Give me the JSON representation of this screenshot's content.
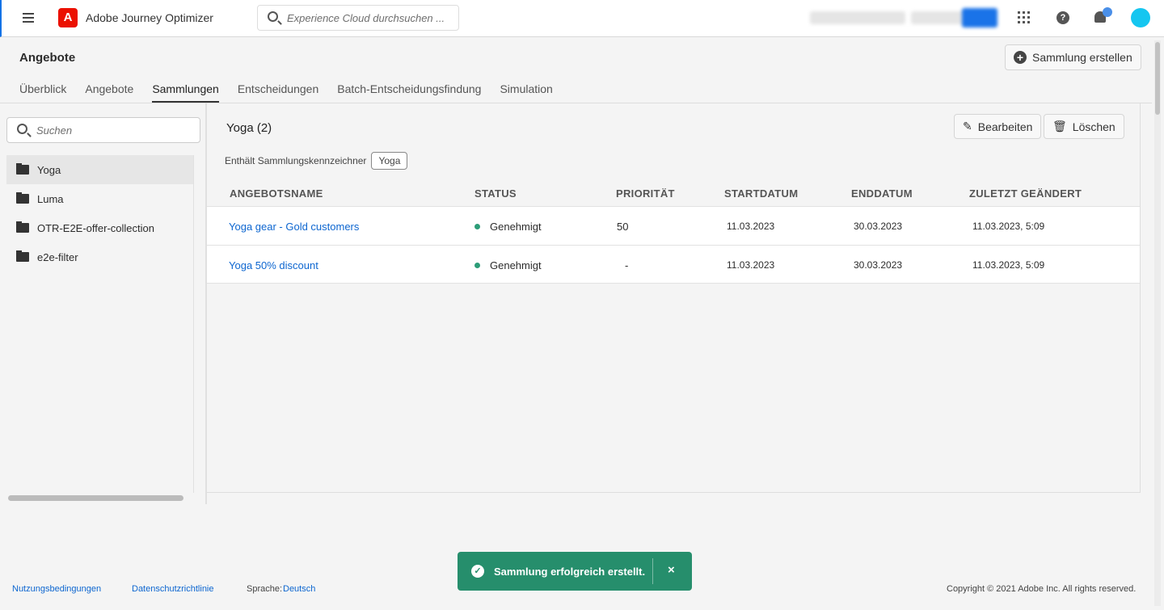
{
  "header": {
    "app_title": "Adobe Journey Optimizer",
    "logo_letter": "A",
    "search_placeholder": "Experience Cloud durchsuchen ...",
    "help_glyph": "?"
  },
  "page": {
    "title": "Angebote",
    "create_button": "Sammlung erstellen",
    "tabs": [
      "Überblick",
      "Angebote",
      "Sammlungen",
      "Entscheidungen",
      "Batch-Entscheidungsfindung",
      "Simulation"
    ]
  },
  "sidebar": {
    "search_placeholder": "Suchen",
    "collections": [
      "Yoga",
      "Luma",
      "OTR-E2E-offer-collection",
      "e2e-filter"
    ]
  },
  "main": {
    "title": "Yoga (2)",
    "edit_button": "Bearbeiten",
    "delete_button": "Löschen",
    "contains_label": "Enthält Sammlungskennzeichner",
    "tag": "Yoga",
    "columns": [
      "ANGEBOTSNAME",
      "STATUS",
      "PRIORITÄT",
      "STARTDATUM",
      "ENDDATUM",
      "ZULETZT GEÄNDERT"
    ],
    "rows": [
      {
        "name": "Yoga gear - Gold customers",
        "status": "Genehmigt",
        "priority": "50",
        "start": "11.03.2023",
        "end": "30.03.2023",
        "modified": "11.03.2023, 5:09"
      },
      {
        "name": "Yoga 50% discount",
        "status": "Genehmigt",
        "priority": "-",
        "start": "11.03.2023",
        "end": "30.03.2023",
        "modified": "11.03.2023, 5:09"
      }
    ]
  },
  "footer": {
    "terms": "Nutzungsbedingungen",
    "privacy": "Datenschutzrichtlinie",
    "language_label": "Sprache:",
    "language": "Deutsch",
    "copyright": "Copyright ©  2021 Adobe Inc.  All rights reserved."
  },
  "toast": {
    "message": "Sammlung erfolgreich erstellt.",
    "close": "×",
    "check": "✓"
  },
  "colors": {
    "accent": "#1473e6",
    "link": "#0d66d0",
    "success": "#268e6c",
    "status_green": "#2d9d78"
  }
}
